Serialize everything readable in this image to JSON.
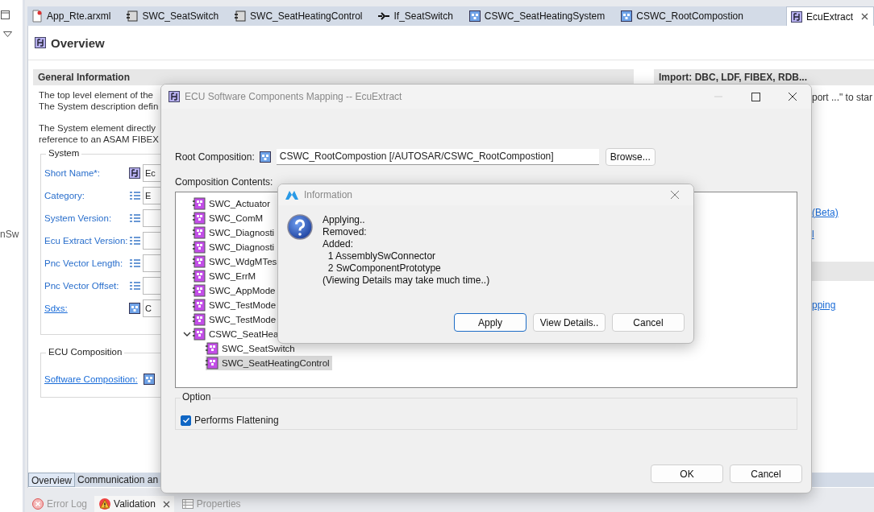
{
  "side_strip": {
    "fragment": "nSw"
  },
  "editor_tabs": [
    {
      "label": "App_Rte.arxml",
      "kind": "file",
      "selected": false
    },
    {
      "label": "SWC_SeatSwitch",
      "kind": "component",
      "selected": false
    },
    {
      "label": "SWC_SeatHeatingControl",
      "kind": "component",
      "selected": false
    },
    {
      "label": "If_SeatSwitch",
      "kind": "interface",
      "selected": false
    },
    {
      "label": "CSWC_SeatHeatingSystem",
      "kind": "composition",
      "selected": false
    },
    {
      "label": "CSWC_RootCompostion",
      "kind": "composition",
      "selected": false
    },
    {
      "label": "EcuExtract",
      "kind": "ecu",
      "selected": true
    }
  ],
  "overview": {
    "title": "Overview",
    "general_information": {
      "title": "General Information",
      "paragraphs": [
        [
          "The top level element of the",
          "The System description defin"
        ],
        [
          "The System element directly",
          "reference to an ASAM FIBEX"
        ]
      ]
    },
    "system": {
      "title": "System",
      "fields": [
        {
          "label": "Short Name*:",
          "underlined": false,
          "kind": "ecu",
          "value": "Ec"
        },
        {
          "label": "Category:",
          "underlined": false,
          "kind": "list",
          "value": "E"
        },
        {
          "label": "System Version:",
          "underlined": false,
          "kind": "list"
        },
        {
          "label": "Ecu Extract Version:",
          "underlined": false,
          "kind": "list"
        },
        {
          "label": "Pnc Vector Length:",
          "underlined": false,
          "kind": "list"
        },
        {
          "label": "Pnc Vector Offset:",
          "underlined": false,
          "kind": "list"
        },
        {
          "label": "Sdxs:",
          "underlined": true,
          "kind": "composition",
          "value": "C"
        }
      ]
    },
    "ecu_composition": {
      "title": "ECU Composition",
      "fields": [
        {
          "label": "Software Composition:",
          "underlined": true,
          "kind": "composition"
        }
      ]
    },
    "import": {
      "title": "Import: DBC, LDF, FIBEX, RDB...",
      "text": "port ...\" to star",
      "links": [
        "(Beta)",
        "l"
      ],
      "link_below": "pping"
    }
  },
  "page_tabs": [
    {
      "label": "Overview",
      "selected": true
    },
    {
      "label": "Communication an",
      "selected": false
    }
  ],
  "views": [
    {
      "label": "Error Log",
      "kind": "error",
      "selected": false,
      "closable": false
    },
    {
      "label": "Validation",
      "kind": "warning",
      "selected": true,
      "closable": true
    },
    {
      "label": "Properties",
      "kind": "properties",
      "selected": false,
      "closable": false
    }
  ],
  "mapping_dialog": {
    "title": "ECU Software Components Mapping -- EcuExtract",
    "root_label": "Root Composition:",
    "root_value": "CSWC_RootCompostion [/AUTOSAR/CSWC_RootCompostion]",
    "browse": "Browse...",
    "contents_label": "Composition Contents:",
    "tree": [
      {
        "label": "SWC_Actuator",
        "selected": false
      },
      {
        "label": "SWC_ComM",
        "selected": false
      },
      {
        "label": "SWC_Diagnosti",
        "selected": false
      },
      {
        "label": "SWC_Diagnosti",
        "selected": false
      },
      {
        "label": "SWC_WdgMTes",
        "selected": false
      },
      {
        "label": "SWC_ErrM",
        "selected": false
      },
      {
        "label": "SWC_AppMode",
        "selected": false
      },
      {
        "label": "SWC_TestMode",
        "selected": false
      },
      {
        "label": "SWC_TestMode",
        "selected": false
      },
      {
        "label": "CSWC_SeatHea",
        "selected": false,
        "expanded": true,
        "children": [
          {
            "label": "SWC_SeatSwitch",
            "selected": false
          },
          {
            "label": "SWC_SeatHeatingControl",
            "selected": true
          }
        ]
      }
    ],
    "option_title": "Option",
    "option": {
      "label": "Performs Flattening",
      "checked": true
    },
    "buttons": [
      {
        "label": "OK",
        "default": false
      },
      {
        "label": "Cancel",
        "default": false
      }
    ]
  },
  "info_dialog": {
    "title": "Information",
    "lines": [
      "Applying..",
      "Removed:",
      "Added:",
      "  1 AssemblySwConnector",
      "  2 SwComponentPrototype",
      "(Viewing Details may take much time..)"
    ],
    "buttons": [
      {
        "label": "Apply",
        "default": true
      },
      {
        "label": "View Details..",
        "default": false
      },
      {
        "label": "Cancel",
        "default": false
      }
    ]
  }
}
